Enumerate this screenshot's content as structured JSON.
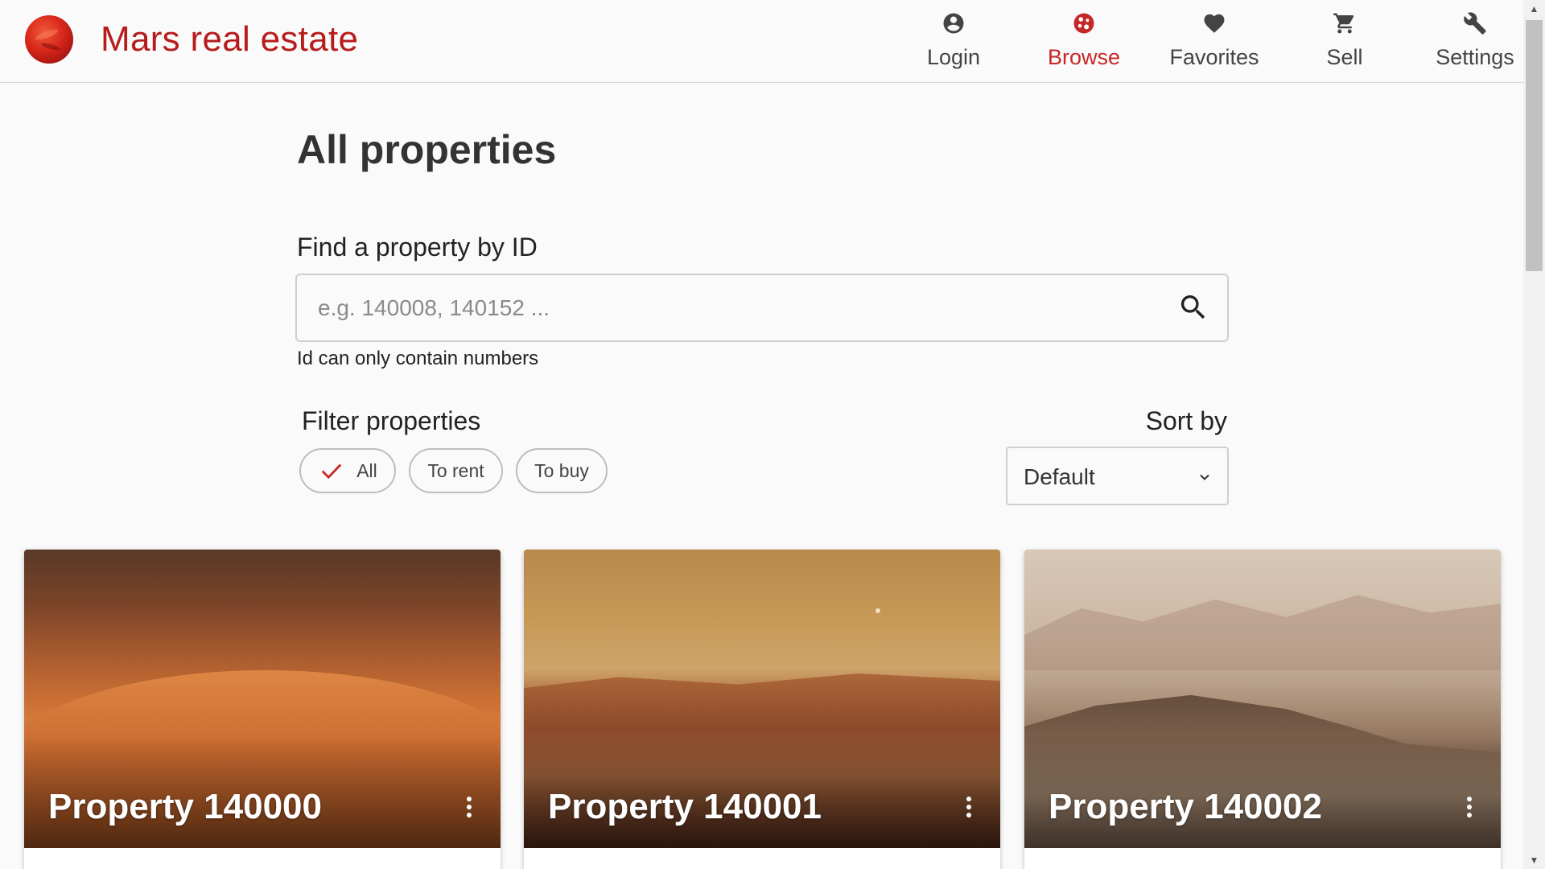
{
  "header": {
    "app_title": "Mars real estate",
    "nav": [
      {
        "label": "Login",
        "icon": "account-circle-icon"
      },
      {
        "label": "Browse",
        "icon": "planet-icon",
        "active": true
      },
      {
        "label": "Favorites",
        "icon": "heart-icon"
      },
      {
        "label": "Sell",
        "icon": "cart-icon"
      },
      {
        "label": "Settings",
        "icon": "wrench-icon"
      }
    ]
  },
  "main": {
    "title": "All properties",
    "search": {
      "label": "Find a property by ID",
      "placeholder": "e.g. 140008, 140152 ...",
      "value": "",
      "hint": "Id can only contain numbers"
    },
    "filter": {
      "title": "Filter properties",
      "options": [
        {
          "label": "All",
          "selected": true
        },
        {
          "label": "To rent",
          "selected": false
        },
        {
          "label": "To buy",
          "selected": false
        }
      ]
    },
    "sort": {
      "label": "Sort by",
      "selected": "Default"
    },
    "properties": [
      {
        "title": "Property 140000"
      },
      {
        "title": "Property 140001"
      },
      {
        "title": "Property 140002"
      }
    ]
  },
  "colors": {
    "accent": "#c62828",
    "title_red": "#b71c1c",
    "background": "#fafafa"
  }
}
